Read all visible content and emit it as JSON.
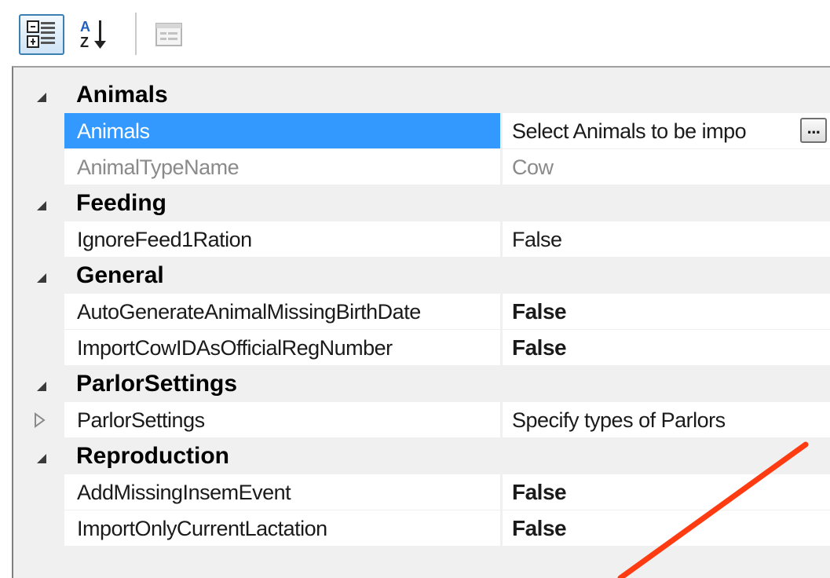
{
  "toolbar": {
    "categorized_icon": "categorized-view-icon",
    "alphabetical_icon": "sort-az-icon",
    "pages_icon": "property-pages-icon"
  },
  "categories": [
    {
      "label": "Animals"
    },
    {
      "label": "Feeding"
    },
    {
      "label": "General"
    },
    {
      "label": "ParlorSettings"
    },
    {
      "label": "Reproduction"
    }
  ],
  "properties": {
    "animals": {
      "name": "Animals",
      "value": "Select Animals to be impo",
      "button": "..."
    },
    "animal_type_name": {
      "name": "AnimalTypeName",
      "value": "Cow"
    },
    "ignore_feed1_ration": {
      "name": "IgnoreFeed1Ration",
      "value": "False"
    },
    "auto_generate": {
      "name": "AutoGenerateAnimalMissingBirthDate",
      "value": "False"
    },
    "import_cow_id": {
      "name": "ImportCowIDAsOfficialRegNumber",
      "value": "False"
    },
    "parlor_settings": {
      "name": "ParlorSettings",
      "value": "Specify types of Parlors"
    },
    "add_missing_insem": {
      "name": "AddMissingInsemEvent",
      "value": "False"
    },
    "import_only_current": {
      "name": "ImportOnlyCurrentLactation",
      "value": "False"
    }
  },
  "colors": {
    "selection": "#3399ff",
    "annotation_arrow": "#ff3b12"
  }
}
